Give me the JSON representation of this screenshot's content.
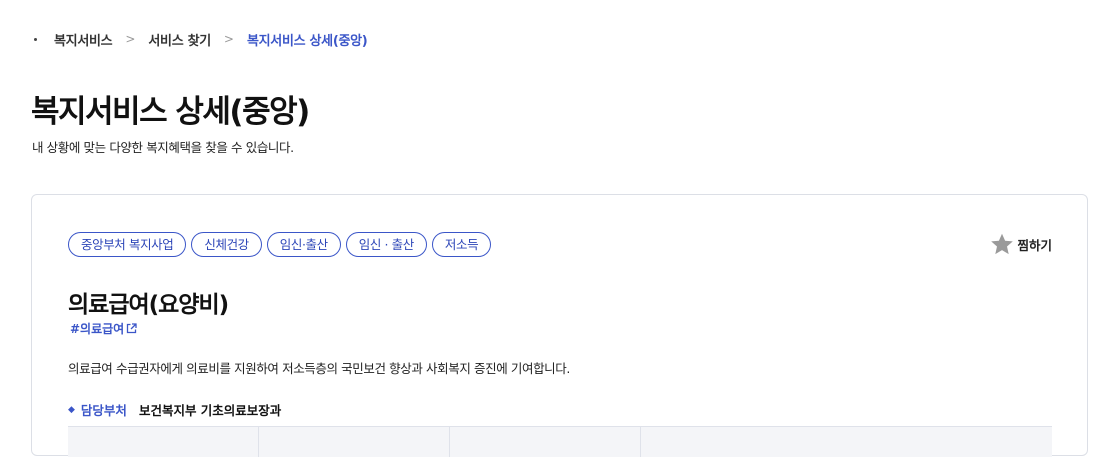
{
  "breadcrumb": {
    "items": [
      "복지서비스",
      "서비스 찾기",
      "복지서비스 상세(중앙)"
    ],
    "separator": ">"
  },
  "page": {
    "title": "복지서비스 상세(중앙)",
    "description": "내 상황에 맞는 다양한 복지혜택을 찾을 수 있습니다."
  },
  "service": {
    "tags": [
      "중앙부처 복지사업",
      "신체건강",
      "임신·출산",
      "임신 · 출산",
      "저소득"
    ],
    "favorite_label": "찜하기",
    "title": "의료급여(요양비)",
    "hashtag": "#의료급여",
    "description": "의료급여 수급권자에게 의료비를 지원하여 저소득층의 국민보건 향상과 사회복지 증진에 기여합니다.",
    "department": {
      "label": "담당부처",
      "value": "보건복지부 기초의료보장과"
    }
  },
  "colors": {
    "accent": "#3b56c8",
    "star": "#9a9a9a",
    "border": "#dcdfe6"
  },
  "icons": {
    "favorite": "star-icon",
    "external": "external-link-icon",
    "bullet": "diamond-bullet-icon"
  }
}
